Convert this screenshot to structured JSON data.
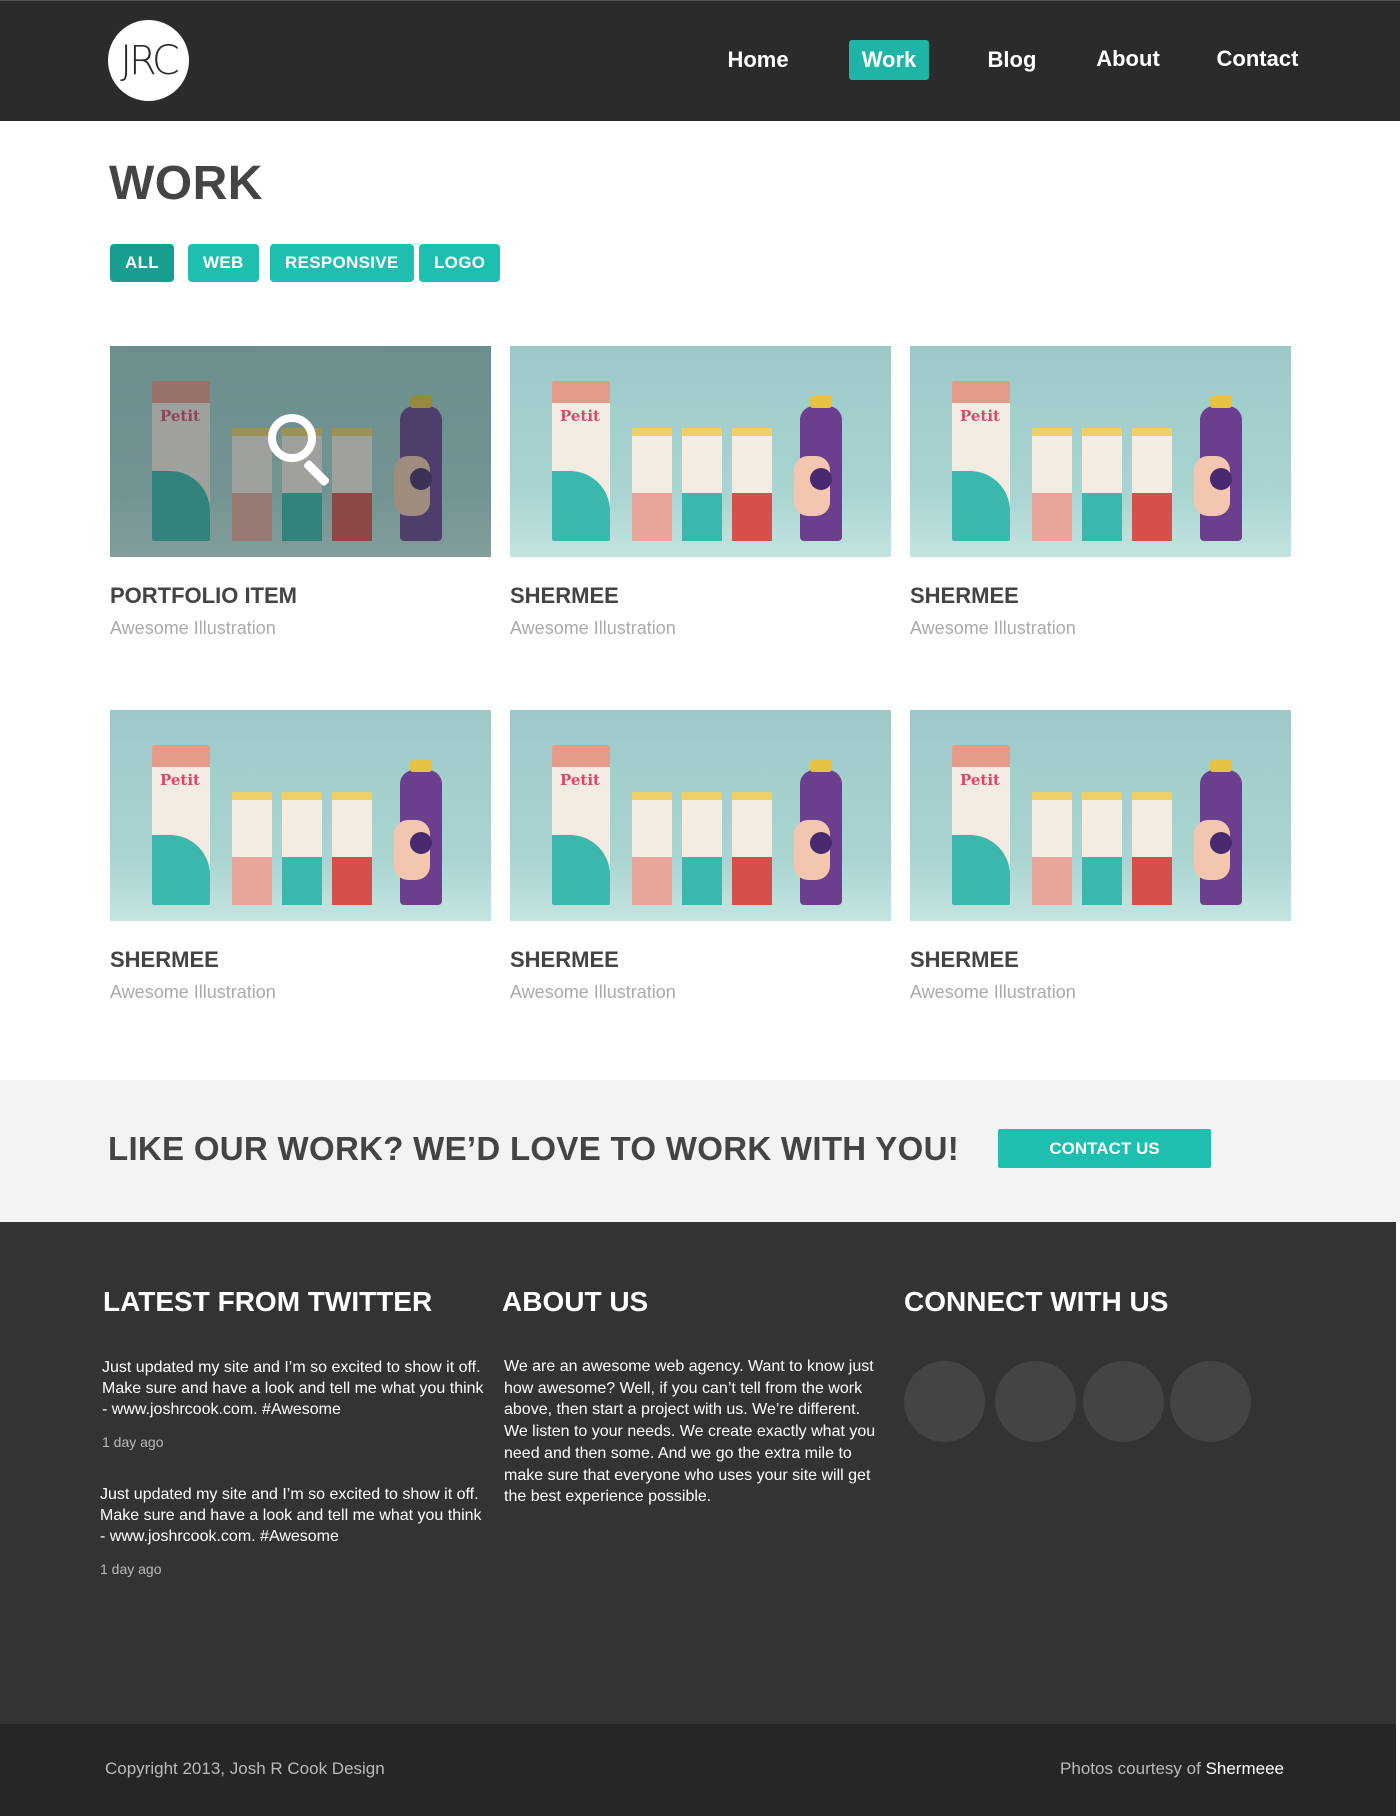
{
  "header": {
    "logo_text": "JRC",
    "nav": [
      {
        "label": "Home",
        "active": false
      },
      {
        "label": "Work",
        "active": true
      },
      {
        "label": "Blog",
        "active": false
      },
      {
        "label": "About",
        "active": false
      },
      {
        "label": "Contact",
        "active": false
      }
    ]
  },
  "work": {
    "title": "WORK",
    "filters": [
      {
        "label": "ALL",
        "active": true
      },
      {
        "label": "WEB",
        "active": false
      },
      {
        "label": "RESPONSIVE",
        "active": false
      },
      {
        "label": "LOGO",
        "active": false
      }
    ],
    "items": [
      {
        "title": "PORTFOLIO ITEM",
        "subtitle": "Awesome Illustration",
        "hover": true,
        "brand": "Petit"
      },
      {
        "title": "SHERMEE",
        "subtitle": "Awesome Illustration",
        "hover": false,
        "brand": "Petit"
      },
      {
        "title": "SHERMEE",
        "subtitle": "Awesome Illustration",
        "hover": false,
        "brand": "Petit"
      },
      {
        "title": "SHERMEE",
        "subtitle": "Awesome Illustration",
        "hover": false,
        "brand": "Petit"
      },
      {
        "title": "SHERMEE",
        "subtitle": "Awesome Illustration",
        "hover": false,
        "brand": "Petit"
      },
      {
        "title": "SHERMEE",
        "subtitle": "Awesome Illustration",
        "hover": false,
        "brand": "Petit"
      }
    ]
  },
  "cta": {
    "text": "LIKE OUR WORK?  WE’D LOVE TO WORK WITH YOU!",
    "button_label": "CONTACT US"
  },
  "footer": {
    "twitter_title": "LATEST FROM TWITTER",
    "tweets": [
      {
        "text": "Just updated my site and I’m so excited to show it off.  Make sure and have a look and tell me what you think - www.joshrcook.com. #Awesome",
        "time": "1 day ago"
      },
      {
        "text": "Just updated my site and I’m so excited to show it off.  Make sure and have a look and tell me what you think - www.joshrcook.com. #Awesome",
        "time": "1 day ago"
      }
    ],
    "about_title": "ABOUT US",
    "about_text": "We are an awesome web agency.  Want to know just how awesome?  Well, if you can’t tell from the work above, then start a project with us.  We’re different.  We listen to your needs.  We create exactly what you need and then some.  And we go the extra mile to make sure that everyone who uses your site will get the best experience possible.",
    "connect_title": "CONNECT WITH US",
    "social_icons": [
      "social-icon-1",
      "social-icon-2",
      "social-icon-3",
      "social-icon-4"
    ]
  },
  "bottom": {
    "copyright": "Copyright 2013, Josh R Cook Design",
    "credit_prefix": "Photos courtesy of ",
    "credit_link": "Shermeee"
  },
  "colors": {
    "accent": "#1fbfb0",
    "header_bg": "#2b2b2b",
    "footer_bg": "#333333"
  }
}
